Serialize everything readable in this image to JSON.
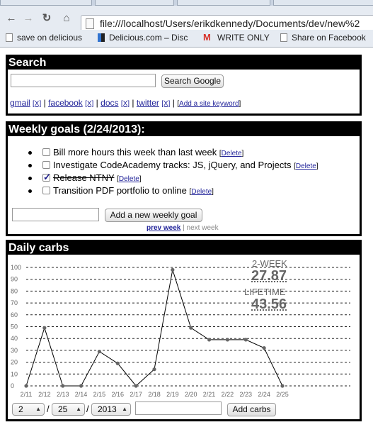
{
  "browser": {
    "url": "file:///localhost/Users/erikdkennedy/Documents/dev/new%2",
    "bookmarks": [
      {
        "label": "save on delicious",
        "icon": "page-icon"
      },
      {
        "label": "Delicious.com – Disc",
        "icon": "delicious-icon"
      },
      {
        "label": "WRITE ONLY",
        "icon": "gmail-icon"
      },
      {
        "label": "Share on Facebook",
        "icon": "page-icon"
      }
    ]
  },
  "search": {
    "title": "Search",
    "input_value": "",
    "button": "Search Google",
    "links": [
      "gmail",
      "facebook",
      "docs",
      "twitter"
    ],
    "remove_marker": "[X]",
    "add_keyword": "Add a site keyword"
  },
  "goals": {
    "title": "Weekly goals (2/24/2013):",
    "items": [
      {
        "text": "Bill more hours this week than last week",
        "checked": false
      },
      {
        "text": "Investigate CodeAcademy tracks: JS, jQuery, and Projects",
        "checked": false
      },
      {
        "text": "Release NTNY",
        "checked": true
      },
      {
        "text": "Transition PDF portfolio to online",
        "checked": false
      }
    ],
    "delete_label": "Delete",
    "input_value": "",
    "add_button": "Add a new weekly goal",
    "prev_week": "prev week",
    "separator": "|",
    "next_week": "next week"
  },
  "carbs": {
    "title": "Daily carbs",
    "two_week_label": "2-WEEK",
    "two_week_value": "27.87",
    "lifetime_label": "LIFETIME",
    "lifetime_value": "43.56",
    "month": "2",
    "day": "25",
    "year": "2013",
    "date_sep": "/",
    "amount_value": "",
    "add_button": "Add carbs"
  },
  "chart_data": {
    "type": "line",
    "x": [
      "2/11",
      "2/12",
      "2/13",
      "2/14",
      "2/15",
      "2/16",
      "2/17",
      "2/18",
      "2/19",
      "2/20",
      "2/21",
      "2/22",
      "2/23",
      "2/24",
      "2/25"
    ],
    "values": [
      0,
      49,
      0,
      0,
      29,
      19,
      0,
      14,
      98,
      49,
      39,
      39,
      39,
      32,
      0
    ],
    "ylim": [
      0,
      100
    ],
    "yticks": [
      0,
      10,
      20,
      30,
      40,
      50,
      60,
      70,
      80,
      90,
      100
    ],
    "grid": true,
    "line_color": "#000000",
    "point_color": "#666666"
  }
}
